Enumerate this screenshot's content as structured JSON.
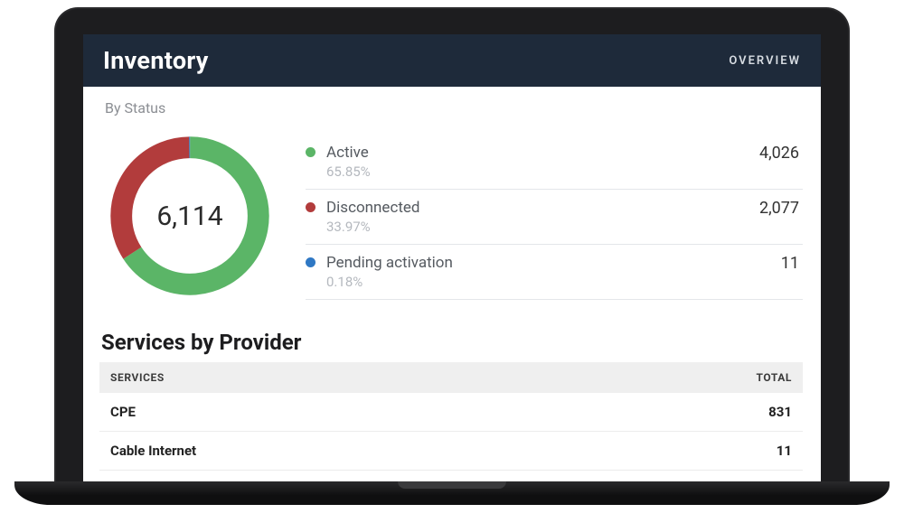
{
  "header": {
    "title": "Inventory",
    "nav_label": "OVERVIEW"
  },
  "by_status": {
    "label": "By Status",
    "total": "6,114",
    "items": [
      {
        "name": "Active",
        "pct": "65.85%",
        "count": "4,026",
        "color": "#5bb567"
      },
      {
        "name": "Disconnected",
        "pct": "33.97%",
        "count": "2,077",
        "color": "#b23c3c"
      },
      {
        "name": "Pending activation",
        "pct": "0.18%",
        "count": "11",
        "color": "#2f78c4"
      }
    ]
  },
  "providers": {
    "heading": "Services by Provider",
    "columns": {
      "service": "SERVICES",
      "total": "TOTAL"
    },
    "rows": [
      {
        "name": "CPE",
        "total": "831",
        "link": false
      },
      {
        "name": "Cable Internet",
        "total": "11",
        "link": true
      }
    ]
  },
  "chart_data": {
    "type": "pie",
    "title": "By Status",
    "total": 6114,
    "series": [
      {
        "name": "Active",
        "value": 4026,
        "pct": 65.85,
        "color": "#5bb567"
      },
      {
        "name": "Disconnected",
        "value": 2077,
        "pct": 33.97,
        "color": "#b23c3c"
      },
      {
        "name": "Pending activation",
        "value": 11,
        "pct": 0.18,
        "color": "#2f78c4"
      }
    ]
  }
}
